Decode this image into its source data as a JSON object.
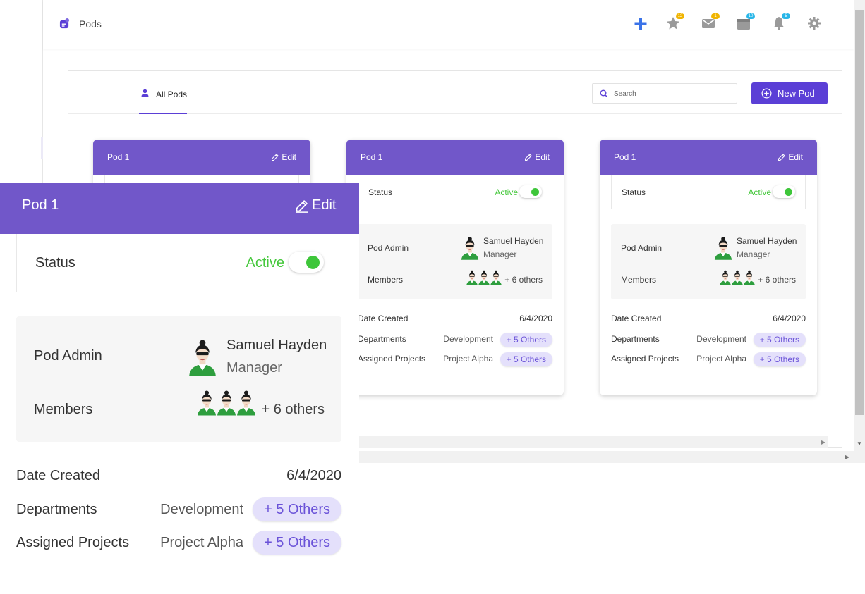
{
  "app": {
    "title": "Pods"
  },
  "topbar": {
    "badges": {
      "favorites": "12",
      "messages": "1",
      "calendar": "10",
      "notifications": "5"
    }
  },
  "tabs": [
    {
      "label": "All Pods"
    }
  ],
  "search": {
    "placeholder": "Search"
  },
  "new_pod_button": {
    "label": "New Pod"
  },
  "colors": {
    "accent": "#5b3fd6",
    "card_header": "#7157c9",
    "active_green": "#47c83e",
    "pill_bg": "#e4e0fb",
    "pill_text": "#6a52d8"
  },
  "cards": [
    {
      "title": "Pod 1",
      "edit_label": "Edit",
      "status_label": "Status",
      "status_value": "Active",
      "admin_label": "Pod Admin",
      "admin_name": "Samuel Hayden",
      "admin_role": "Manager",
      "members_label": "Members",
      "members_more": "+ 6 others",
      "date_label": "Date Created",
      "date_value": "6/4/2020",
      "departments_label": "Departments",
      "departments_value": "Development",
      "departments_more": "+ 5 Others",
      "projects_label": "Assigned Projects",
      "projects_value": "Project Alpha",
      "projects_more": "+ 5 Others"
    },
    {
      "title": "Pod 1",
      "edit_label": "Edit",
      "status_label": "Status",
      "status_value": "Active",
      "admin_label": "Pod Admin",
      "admin_name": "Samuel Hayden",
      "admin_role": "Manager",
      "members_label": "Members",
      "members_more": "+ 6 others",
      "date_label": "Date Created",
      "date_value": "6/4/2020",
      "departments_label": "Departments",
      "departments_value": "Development",
      "departments_more": "+ 5 Others",
      "projects_label": "Assigned Projects",
      "projects_value": "Project Alpha",
      "projects_more": "+ 5 Others"
    },
    {
      "title": "Pod 1",
      "edit_label": "Edit",
      "status_label": "Status",
      "status_value": "Active",
      "admin_label": "Pod Admin",
      "admin_name": "Samuel Hayden",
      "admin_role": "Manager",
      "members_label": "Members",
      "members_more": "+ 6 others",
      "date_label": "Date Created",
      "date_value": "6/4/2020",
      "departments_label": "Departments",
      "departments_value": "Development",
      "departments_more": "+ 5 Others",
      "projects_label": "Assigned Projects",
      "projects_value": "Project Alpha",
      "projects_more": "+ 5 Others"
    }
  ],
  "zoom_card": {
    "title": "Pod 1",
    "edit_label": "Edit",
    "status_label": "Status",
    "status_value": "Active",
    "admin_label": "Pod Admin",
    "admin_name": "Samuel Hayden",
    "admin_role": "Manager",
    "members_label": "Members",
    "members_more": "+ 6 others",
    "date_label": "Date Created",
    "date_value": "6/4/2020",
    "departments_label": "Departments",
    "departments_value": "Development",
    "departments_more": "+ 5 Others",
    "projects_label": "Assigned Projects",
    "projects_value": "Project Alpha",
    "projects_more": "+ 5 Others"
  }
}
